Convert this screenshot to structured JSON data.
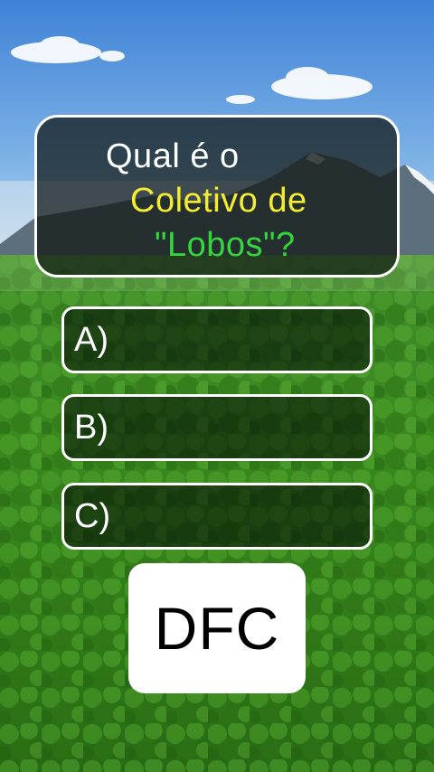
{
  "question": {
    "line1": "Qual é o",
    "line2": "Coletivo de",
    "line3": "\"Lobos\"?"
  },
  "options": [
    {
      "label": "A)"
    },
    {
      "label": "B)"
    },
    {
      "label": "C)"
    }
  ],
  "logo": {
    "text": "DFC"
  },
  "colors": {
    "question_white": "#ffffff",
    "question_yellow": "#f4ec2e",
    "question_green": "#35d63c",
    "sky": "#4f90d8",
    "forest": "#2f7a1c"
  }
}
